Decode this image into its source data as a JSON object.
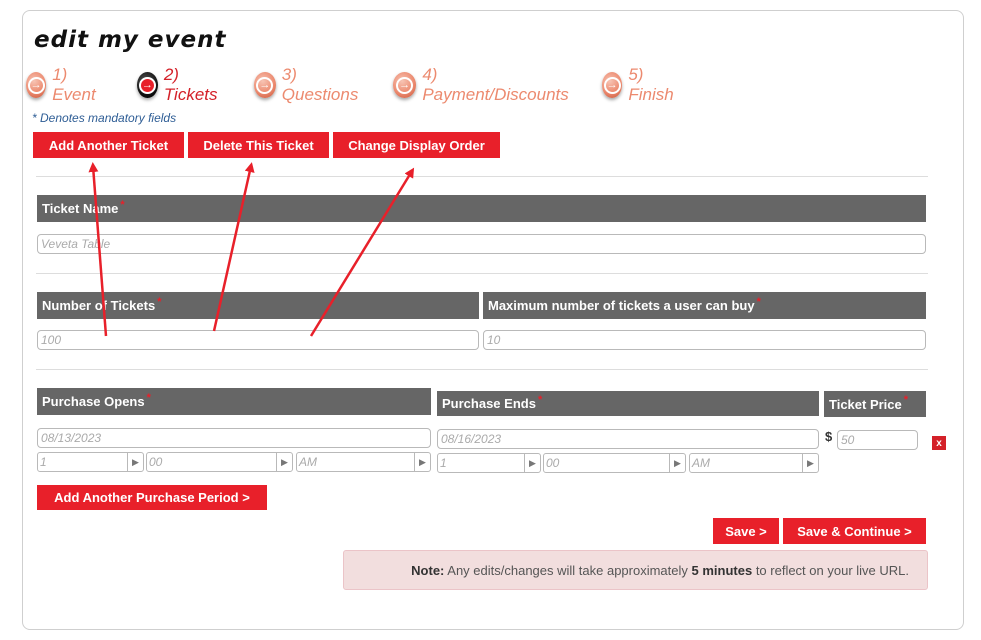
{
  "page": {
    "title": "edit my event"
  },
  "steps": [
    {
      "label": "1) Event",
      "active": false
    },
    {
      "label": "2) Tickets",
      "active": true
    },
    {
      "label": "3) Questions",
      "active": false
    },
    {
      "label": "4) Payment/Discounts",
      "active": false
    },
    {
      "label": "5) Finish",
      "active": false
    }
  ],
  "mandatory_note": "* Denotes mandatory fields",
  "toolbar": {
    "add_ticket": "Add Another Ticket",
    "delete_ticket": "Delete This Ticket",
    "change_order": "Change Display Order"
  },
  "required_mark": "*",
  "ticket_name": {
    "label": "Ticket Name",
    "value": "Veveta Table"
  },
  "num_tickets": {
    "label": "Number of Tickets",
    "value": "100"
  },
  "max_per_user": {
    "label": "Maximum number of tickets a user can buy",
    "value": "10"
  },
  "purchase_opens": {
    "label": "Purchase Opens",
    "date": "08/13/2023",
    "hour": "1",
    "minute": "00",
    "ampm": "AM"
  },
  "purchase_ends": {
    "label": "Purchase Ends",
    "date": "08/16/2023",
    "hour": "1",
    "minute": "00",
    "ampm": "AM"
  },
  "ticket_price": {
    "label": "Ticket Price",
    "currency": "$",
    "value": "50"
  },
  "remove_label": "x",
  "add_period": "Add Another Purchase Period >",
  "actions": {
    "save": "Save >",
    "save_continue": "Save & Continue >"
  },
  "note": {
    "prefix": "Note:",
    "text1": " Any edits/changes will take approximately ",
    "bold": "5 minutes",
    "text2": " to reflect on your live URL."
  },
  "colors": {
    "accent": "#e8202a",
    "label_bg": "#666666",
    "step_inactive": "#ec8a6f",
    "annotation": "#e8202a"
  }
}
